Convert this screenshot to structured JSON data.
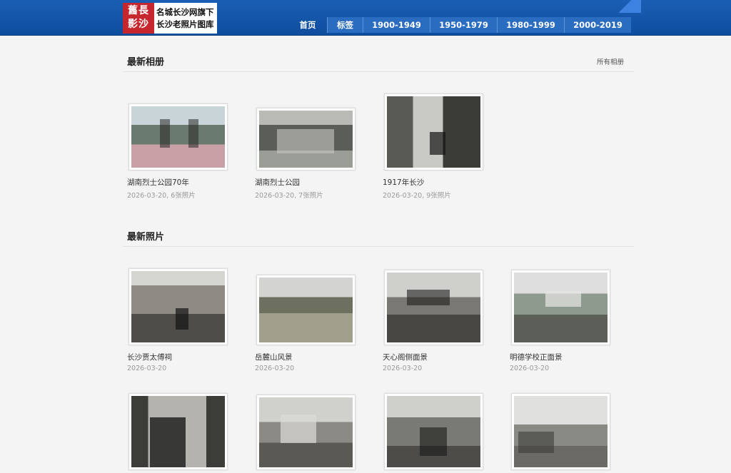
{
  "header": {
    "logo_seal": "舊長\n影沙",
    "logo_line1": "名城长沙网旗下",
    "logo_line2": "长沙老照片图库",
    "nav": [
      {
        "label": "首页"
      },
      {
        "label": "标签"
      },
      {
        "label": "1900-1949"
      },
      {
        "label": "1950-1979"
      },
      {
        "label": "1980-1999"
      },
      {
        "label": "2000-2019"
      }
    ]
  },
  "albums": {
    "title": "最新相册",
    "all_link": "所有相册",
    "items": [
      {
        "title": "湖南烈士公园70年",
        "meta": "2026-03-20, 6张照片"
      },
      {
        "title": "湖南烈士公园",
        "meta": "2026-03-20, 7张照片"
      },
      {
        "title": "1917年长沙",
        "meta": "2026-03-20, 9张照片"
      }
    ]
  },
  "photos": {
    "title": "最新照片",
    "items": [
      {
        "title": "长沙贾太傅祠",
        "meta": "2026-03-20"
      },
      {
        "title": "岳麓山风景",
        "meta": "2026-03-20"
      },
      {
        "title": "天心阁侧面景",
        "meta": "2026-03-20"
      },
      {
        "title": "明德学校正面景",
        "meta": "2026-03-20"
      }
    ]
  }
}
